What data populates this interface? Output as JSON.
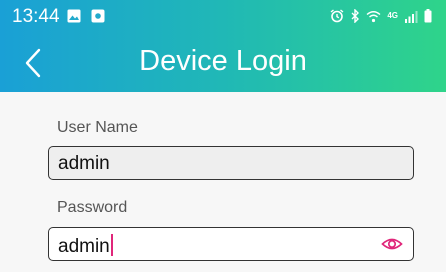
{
  "status_bar": {
    "time": "13:44",
    "left_icons": [
      "image-icon",
      "app-notification-icon"
    ],
    "right_icons": [
      "alarm-icon",
      "bluetooth-icon",
      "wifi-icon",
      "network-4g-icon",
      "signal-icon",
      "battery-icon"
    ],
    "network_label": "4G"
  },
  "header": {
    "title": "Device Login",
    "back_icon": "chevron-left-icon",
    "gradient_start": "#1aa0d6",
    "gradient_end": "#2fd48a"
  },
  "form": {
    "username_label": "User Name",
    "username_value": "admin",
    "password_label": "Password",
    "password_value": "admin",
    "password_toggle_icon": "eye-icon",
    "accent_color": "#e0267a"
  }
}
